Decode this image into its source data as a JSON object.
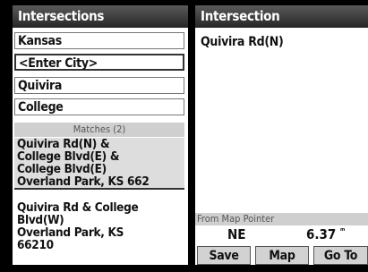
{
  "left_panel": {
    "title": "Intersections",
    "fields": [
      "Kansas",
      "<Enter City>",
      "Quivira",
      "College"
    ],
    "matches_header": "Matches (2)",
    "results": [
      {
        "lines": [
          "Quivira Rd(N) &",
          "College Blvd(E) &",
          "College Blvd(E)",
          "Overland Park, KS 662"
        ]
      },
      {
        "lines": [
          "Quivira Rd & College",
          "Blvd(W)",
          "Overland Park, KS",
          "66210"
        ]
      }
    ]
  },
  "right_panel": {
    "title": "Intersection",
    "name": "Quivira Rd(N)",
    "from_map_pointer_label": "From Map Pointer",
    "direction": "NE",
    "distance": "6.37",
    "buttons": {
      "save": "Save",
      "map": "Map",
      "go_to": "Go To"
    }
  }
}
